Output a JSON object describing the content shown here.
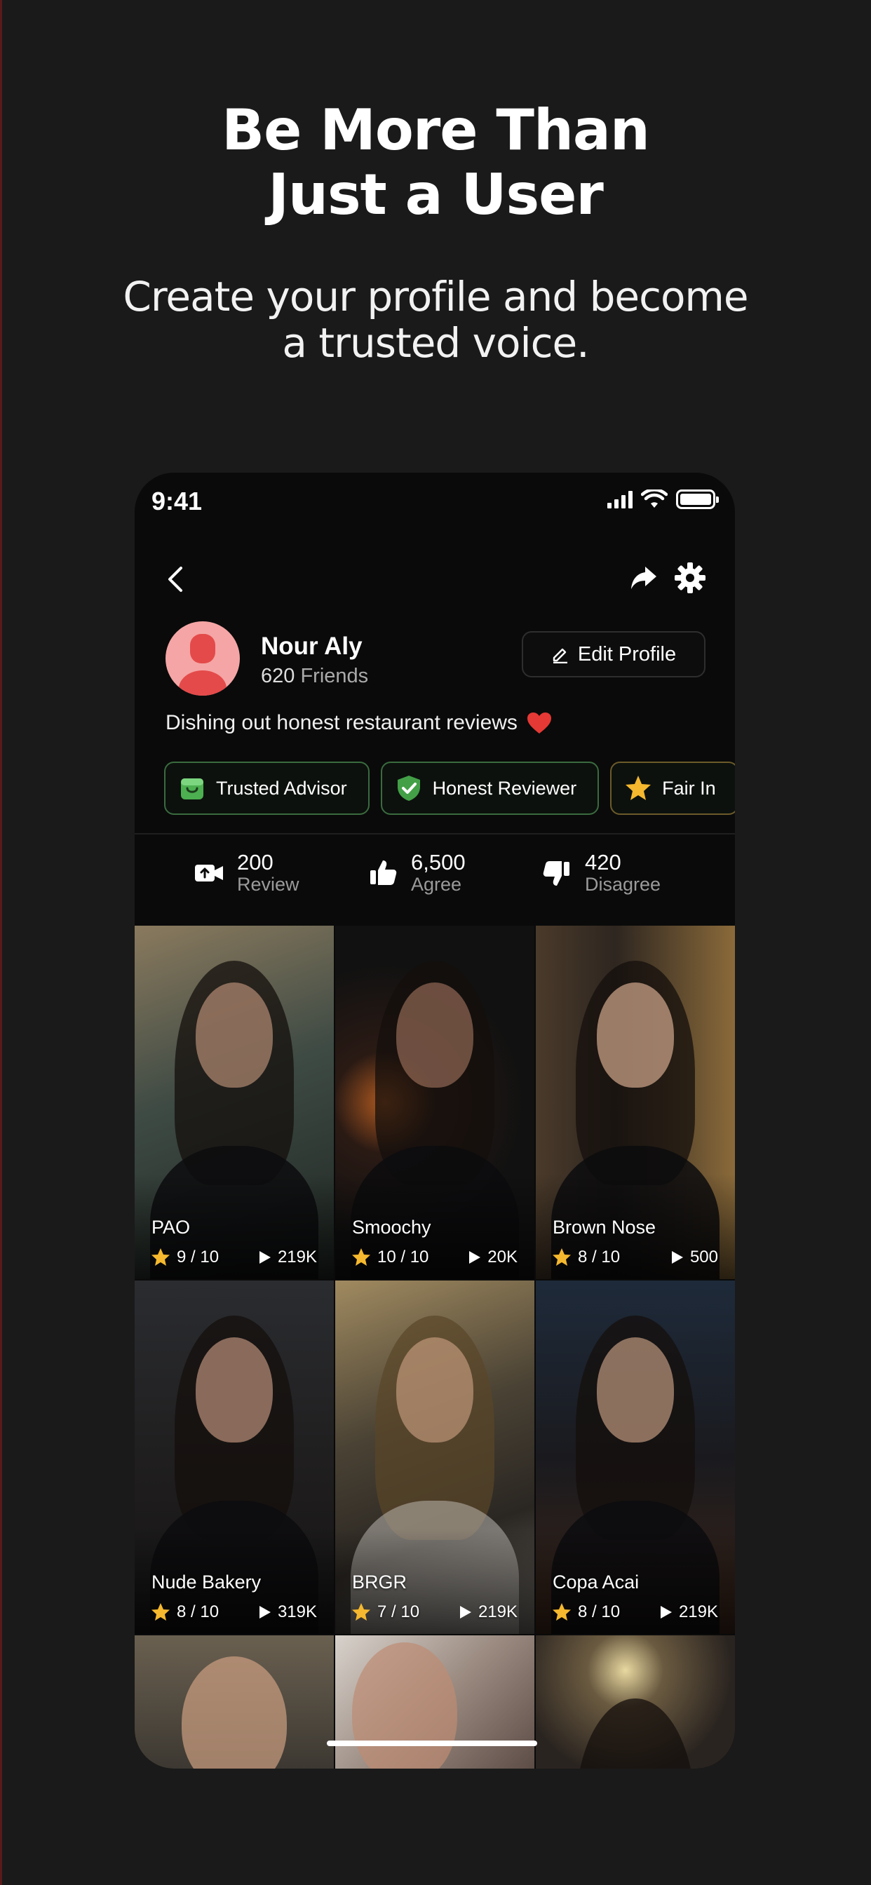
{
  "promo": {
    "headline_line1": "Be More Than",
    "headline_line2": "Just a User",
    "sub_line1": "Create your profile and become",
    "sub_line2": "a trusted voice."
  },
  "status_bar": {
    "time": "9:41"
  },
  "profile": {
    "name": "Nour Aly",
    "friends_count": "620",
    "friends_label": "Friends",
    "edit_label": "Edit Profile",
    "bio": "Dishing out honest restaurant reviews"
  },
  "badges": [
    {
      "label": "Trusted Advisor",
      "icon": "shopping-bag-icon"
    },
    {
      "label": "Honest Reviewer",
      "icon": "shield-check-icon"
    },
    {
      "label": "Fair In",
      "icon": "star-icon"
    }
  ],
  "stats": [
    {
      "value": "200",
      "label": "Review",
      "icon": "video-upload-icon"
    },
    {
      "value": "6,500",
      "label": "Agree",
      "icon": "thumbs-up-icon"
    },
    {
      "value": "420",
      "label": "Disagree",
      "icon": "thumbs-down-icon"
    }
  ],
  "reviews": [
    {
      "title": "PAO",
      "rating": "9 / 10",
      "views": "219K"
    },
    {
      "title": "Smoochy",
      "rating": "10 / 10",
      "views": "20K"
    },
    {
      "title": "Brown Nose",
      "rating": "8 / 10",
      "views": "500"
    },
    {
      "title": "Nude Bakery",
      "rating": "8 / 10",
      "views": "319K"
    },
    {
      "title": "BRGR",
      "rating": "7 / 10",
      "views": "219K"
    },
    {
      "title": "Copa Acai",
      "rating": "8 / 10",
      "views": "219K"
    }
  ],
  "colors": {
    "background": "#1a1a1a",
    "phone_bg": "#0a0a0a",
    "badge_green_border": "#3a6b3f",
    "badge_gold_border": "#6b5a2a",
    "avatar_pink": "#f5a5a5",
    "star_gold": "#f5b82e",
    "heart_red": "#e53935"
  }
}
